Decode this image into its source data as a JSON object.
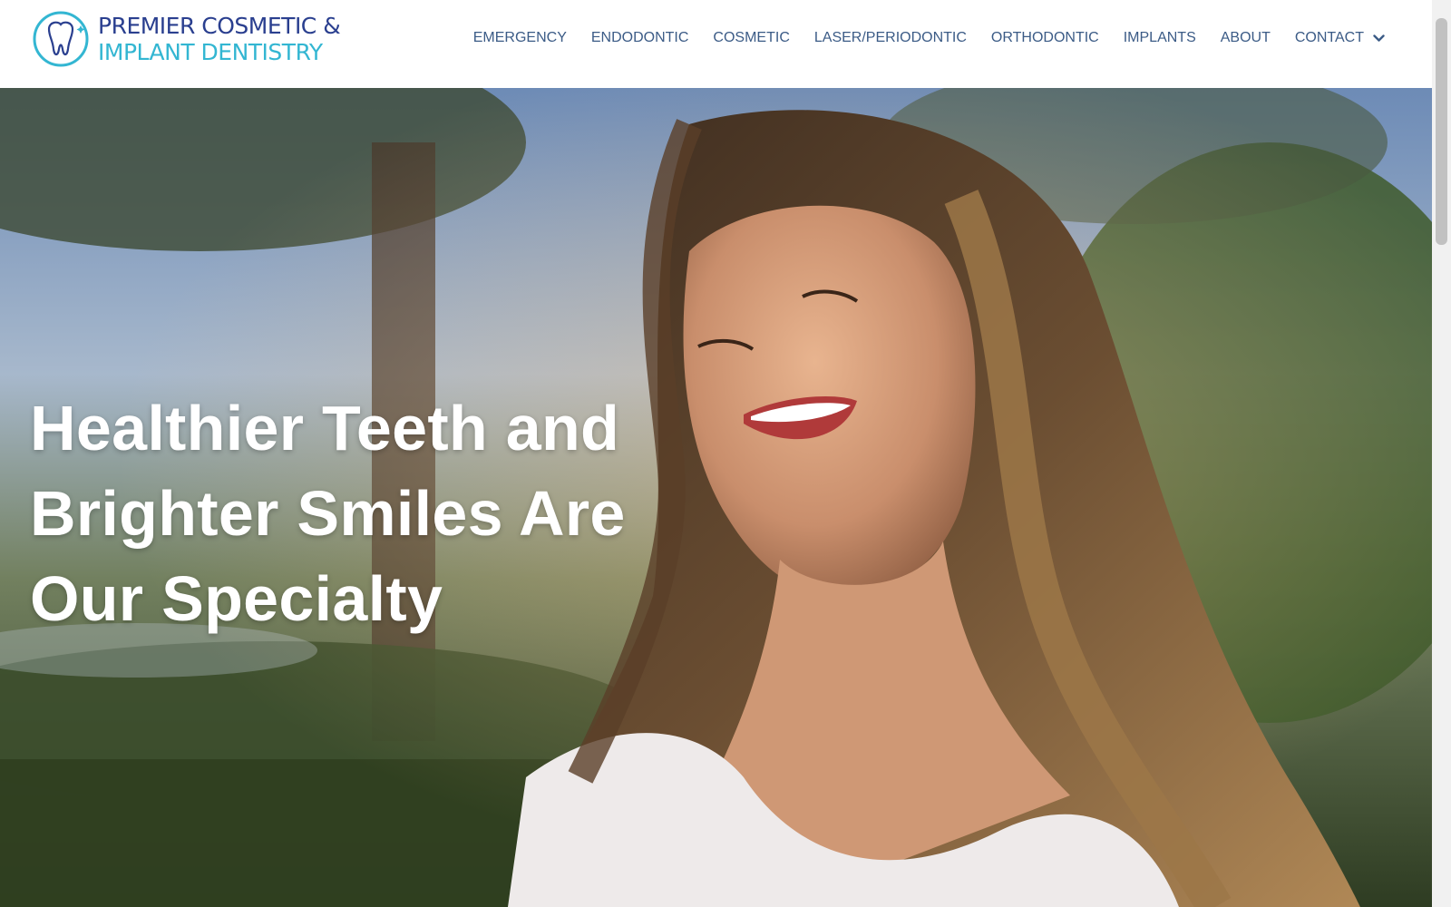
{
  "brand": {
    "line1": "PREMIER COSMETIC &",
    "line2": "IMPLANT DENTISTRY",
    "logo_icon": "tooth-icon",
    "colors": {
      "navy": "#2a3f8f",
      "teal": "#33b6d2"
    }
  },
  "nav": {
    "items": [
      {
        "label": "EMERGENCY"
      },
      {
        "label": "ENDODONTIC"
      },
      {
        "label": "COSMETIC"
      },
      {
        "label": "LASER/PERIODONTIC"
      },
      {
        "label": "ORTHODONTIC"
      },
      {
        "label": "IMPLANTS"
      },
      {
        "label": "ABOUT"
      }
    ],
    "contact": {
      "label": "CONTACT",
      "icon": "chevron-down-icon"
    },
    "color": "#3b5b86"
  },
  "hero": {
    "headline_line1": "Healthier Teeth and",
    "headline_line2": "Brighter Smiles Are",
    "headline_line3": "Our Specialty"
  }
}
